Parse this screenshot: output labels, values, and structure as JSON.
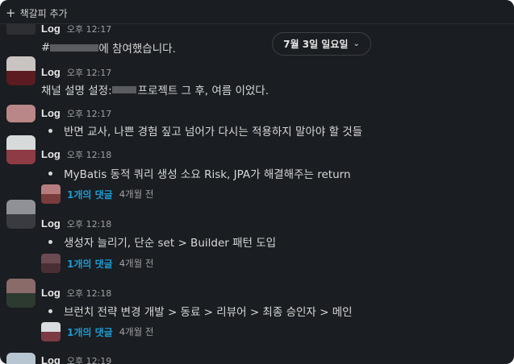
{
  "toolbar": {
    "add_bookmark_label": "책갈피 추가",
    "plus_icon": "+"
  },
  "date_divider": {
    "label": "7월 3일 일요일",
    "chevron": "⌄"
  },
  "messages": [
    {
      "author": "Log",
      "time": "오후 12:17",
      "text_prefix": "#",
      "text_suffix": "에 참여했습니다.",
      "colors": [
        "#2e2f33",
        "#2e2f33"
      ]
    },
    {
      "author": "Log",
      "time": "오후 12:17",
      "text_prefix": "채널 설명 설정: ",
      "text_suffix": "프로젝트 그 후, 여름 이었다.",
      "colors": [
        "#c9c4c2",
        "#5b1b21"
      ]
    },
    {
      "author": "Log",
      "time": "오후 12:17",
      "text": "반면 교사, 나쁜 경험 짚고 넘어가 다시는 적용하지 말아야 할 것들",
      "colors": [
        "#b98787",
        "#a06a6c"
      ]
    },
    {
      "author": "Log",
      "time": "오후 12:18",
      "text": "MyBatis 동적 쿼리 생성 소요 Risk, JPA가 해결해주는 return",
      "colors": [
        "#d6dadb",
        "#8f3b45"
      ],
      "thread": {
        "link": "1개의 댓글",
        "ago": "4개월 전",
        "colors": [
          "#b77d7e",
          "#7a3b3d"
        ]
      }
    },
    {
      "author": "Log",
      "time": "오후 12:18",
      "text": "생성자 늘리기, 단순 set > Builder 패턴 도입",
      "colors": [
        "#8f9196",
        "#3a3b40"
      ],
      "thread": {
        "link": "1개의 댓글",
        "ago": "4개월 전",
        "colors": [
          "#6c4a52",
          "#4a2e35"
        ]
      }
    },
    {
      "author": "Log",
      "time": "오후 12:18",
      "text": "브런치 전략 변경 개발 > 동료 > 리뷰어 > 최종 승인자 > 메인",
      "colors": [
        "#8b6a6a",
        "#2d3a30"
      ],
      "thread": {
        "link": "1개의 댓글",
        "ago": "4개월 전",
        "colors": [
          "#d9dde0",
          "#7b3a44"
        ]
      }
    },
    {
      "author": "Log",
      "time": "오후 12:19",
      "colors": [
        "#b7c6d0",
        "#7a8b95"
      ]
    }
  ]
}
